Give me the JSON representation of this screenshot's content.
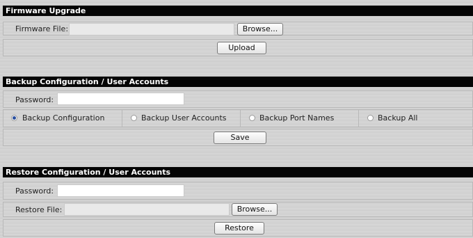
{
  "firmware": {
    "title": "Firmware Upgrade",
    "file_label": "Firmware File:",
    "file_value": "",
    "browse_label": "Browse...",
    "upload_label": "Upload"
  },
  "backup": {
    "title": "Backup Configuration / User Accounts",
    "password_label": "Password:",
    "password_value": "",
    "options": [
      {
        "label": "Backup Configuration",
        "selected": true
      },
      {
        "label": "Backup User Accounts",
        "selected": false
      },
      {
        "label": "Backup Port Names",
        "selected": false
      },
      {
        "label": "Backup All",
        "selected": false
      }
    ],
    "save_label": "Save"
  },
  "restore": {
    "title": "Restore Configuration / User Accounts",
    "password_label": "Password:",
    "password_value": "",
    "file_label": "Restore File:",
    "file_value": "",
    "browse_label": "Browse...",
    "restore_label": "Restore"
  }
}
